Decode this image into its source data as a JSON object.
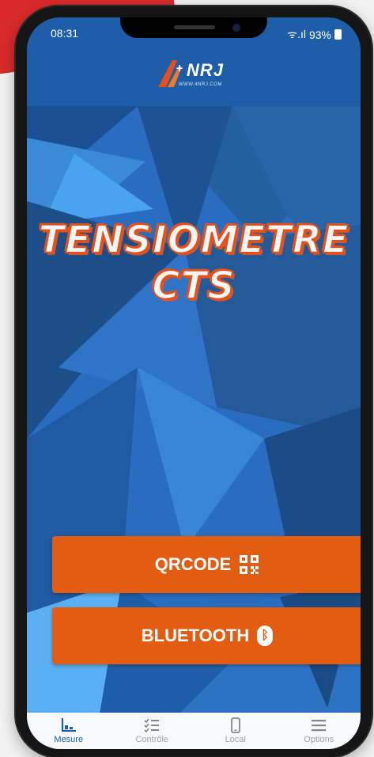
{
  "status_bar": {
    "time": "08:31",
    "signal": "ᯤ.ıl",
    "battery": "93%"
  },
  "header": {
    "logo_brand": "NRJ",
    "logo_url": "WWW.4NRJ.COM"
  },
  "title": {
    "line1": "TENSIOMETRE",
    "line2": "CTS"
  },
  "actions": {
    "qrcode_label": "QRCODE",
    "bluetooth_label": "BLUETOOTH"
  },
  "tabs": [
    {
      "label": "Mesure",
      "icon": "chart-icon"
    },
    {
      "label": "Contrôle",
      "icon": "checklist-icon"
    },
    {
      "label": "Local",
      "icon": "phone-icon"
    },
    {
      "label": "Options",
      "icon": "menu-icon"
    }
  ],
  "colors": {
    "accent_orange": "#e25d12",
    "brand_blue": "#1e5ea9",
    "tab_active": "#1e5ea9",
    "tab_inactive": "#9aa3af"
  }
}
